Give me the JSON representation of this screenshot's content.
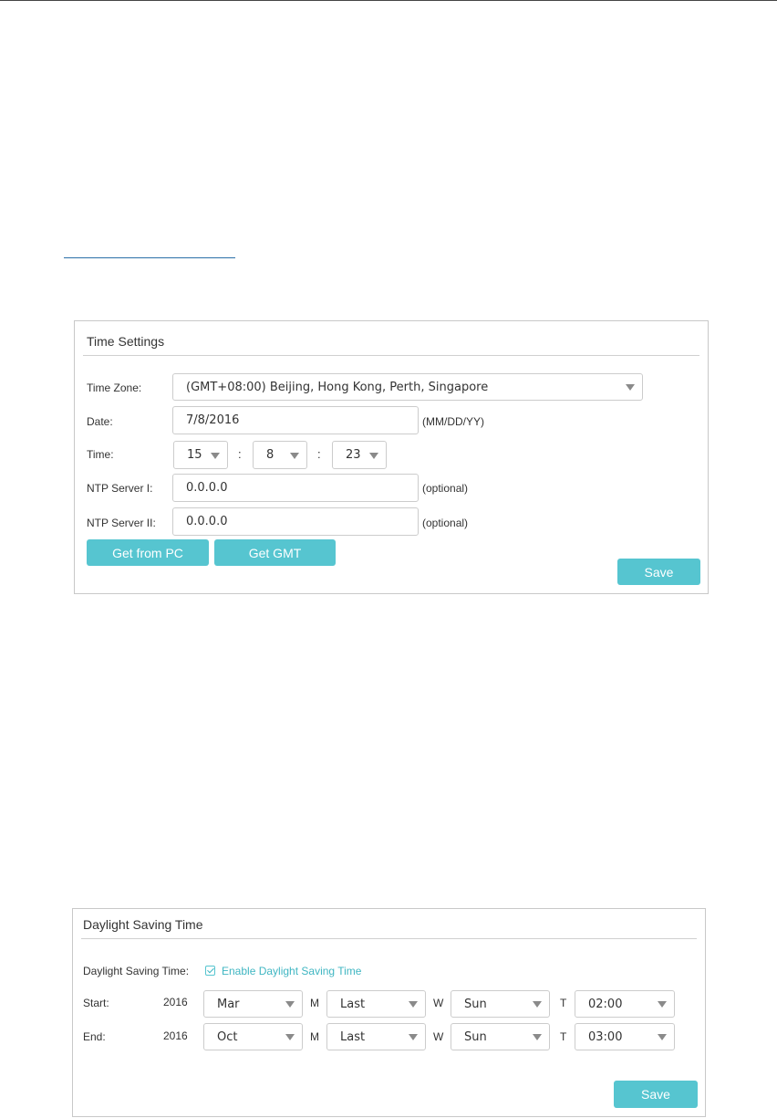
{
  "time_settings": {
    "title": "Time Settings",
    "time_zone_label": "Time Zone:",
    "time_zone_value": "(GMT+08:00) Beijing, Hong Kong, Perth, Singapore",
    "date_label": "Date:",
    "date_value": "7/8/2016",
    "date_hint": "(MM/DD/YY)",
    "time_label": "Time:",
    "time_hour": "15",
    "time_minute": "8",
    "time_second": "23",
    "time_separator": ":",
    "ntp1_label": "NTP Server I:",
    "ntp1_value": "0.0.0.0",
    "ntp1_hint": "(optional)",
    "ntp2_label": "NTP Server II:",
    "ntp2_value": "0.0.0.0",
    "ntp2_hint": "(optional)",
    "get_from_pc_label": "Get from PC",
    "get_gmt_label": "Get GMT",
    "save_label": "Save"
  },
  "dst": {
    "title": "Daylight Saving Time",
    "dst_label": "Daylight Saving Time:",
    "enable_label": "Enable Daylight Saving Time",
    "enabled": true,
    "start": {
      "label": "Start:",
      "year": "2016",
      "month": "Mar",
      "week": "Last",
      "day": "Sun",
      "time": "02:00"
    },
    "end": {
      "label": "End:",
      "year": "2016",
      "month": "Oct",
      "week": "Last",
      "day": "Sun",
      "time": "03:00"
    },
    "month_unit": "M",
    "week_unit": "W",
    "time_unit": "T",
    "save_label": "Save"
  },
  "colors": {
    "accent": "#56c5d0",
    "border": "#cccccc",
    "text": "#333333"
  }
}
